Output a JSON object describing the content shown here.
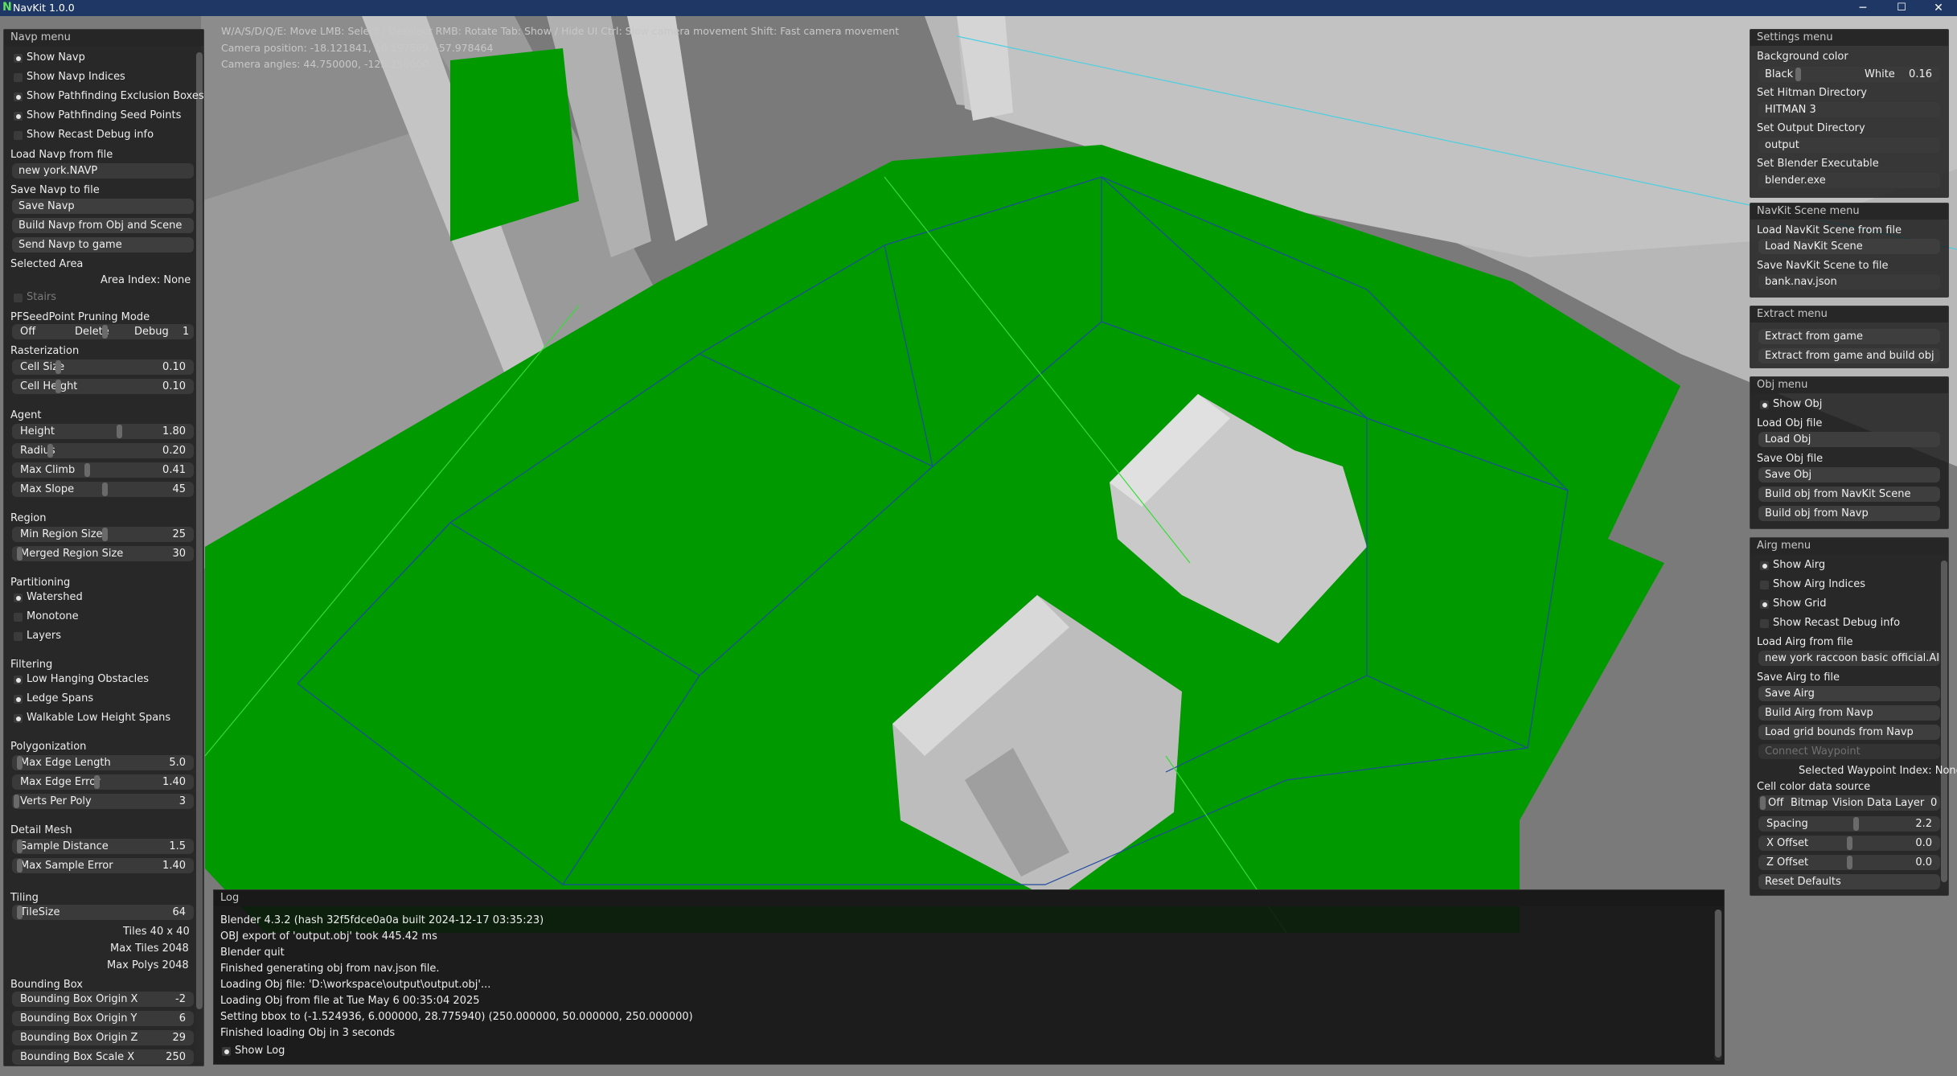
{
  "window": {
    "title": "NavKit 1.0.0",
    "minimize": "─",
    "maximize": "☐",
    "close": "✕"
  },
  "hud": {
    "controls": "W/A/S/D/Q/E: Move  LMB: Select / Deselect RMB: Rotate  Tab: Show / Hide UI  Ctrl: Slow camera movement  Shift: Fast camera movement",
    "camera_position": "Camera position: -18.121841, 10.197569, -57.978464",
    "camera_angles": "Camera angles: 44.750000, -125.250000"
  },
  "navp": {
    "title": "Navp menu",
    "show_navp": "Show Navp",
    "show_indices": "Show Navp Indices",
    "show_excl": "Show Pathfinding Exclusion Boxes",
    "show_seed": "Show Pathfinding Seed Points",
    "show_recast": "Show Recast Debug info",
    "load_label": "Load Navp from file",
    "load_value": "new york.NAVP",
    "save_label": "Save Navp to file",
    "save_btn": "Save Navp",
    "build_btn": "Build Navp from Obj and Scene",
    "send_btn": "Send Navp to game",
    "selected_area": "Selected Area",
    "area_index": "Area Index: None",
    "stairs": "Stairs",
    "pf_mode": "PFSeedPoint Pruning Mode",
    "pf_off": "Off",
    "pf_delete": "Delete",
    "pf_debug": "Debug",
    "pf_val": "1",
    "rasterization": "Rasterization",
    "cell_size": "Cell Size",
    "cell_size_v": "0.10",
    "cell_height": "Cell Height",
    "cell_height_v": "0.10",
    "agent": "Agent",
    "height": "Height",
    "height_v": "1.80",
    "radius": "Radius",
    "radius_v": "0.20",
    "max_climb": "Max Climb",
    "max_climb_v": "0.41",
    "max_slope": "Max Slope",
    "max_slope_v": "45",
    "region": "Region",
    "min_region": "Min Region Size",
    "min_region_v": "25",
    "merged_region": "Merged Region Size",
    "merged_region_v": "30",
    "partitioning": "Partitioning",
    "watershed": "Watershed",
    "monotone": "Monotone",
    "layers": "Layers",
    "filtering": "Filtering",
    "low_hanging": "Low Hanging Obstacles",
    "ledge": "Ledge Spans",
    "walkable_low": "Walkable Low Height Spans",
    "polygonization": "Polygonization",
    "max_edge_len": "Max Edge Length",
    "max_edge_len_v": "5.0",
    "max_edge_err": "Max Edge Error",
    "max_edge_err_v": "1.40",
    "verts_per_poly": "Verts Per Poly",
    "verts_per_poly_v": "3",
    "detail_mesh": "Detail Mesh",
    "sample_dist": "Sample Distance",
    "sample_dist_v": "1.5",
    "max_sample_err": "Max Sample Error",
    "max_sample_err_v": "1.40",
    "tiling": "Tiling",
    "tile_size": "TileSize",
    "tile_size_v": "64",
    "tiles": "Tiles  40 x 40",
    "max_tiles": "Max Tiles  2048",
    "max_polys": "Max Polys  2048",
    "bbox": "Bounding Box",
    "bbox_ox": "Bounding Box Origin X",
    "bbox_ox_v": "-2",
    "bbox_oy": "Bounding Box Origin Y",
    "bbox_oy_v": "6",
    "bbox_oz": "Bounding Box Origin Z",
    "bbox_oz_v": "29",
    "bbox_sx": "Bounding Box Scale X",
    "bbox_sx_v": "250"
  },
  "settings": {
    "title": "Settings menu",
    "bg_color": "Background color",
    "black": "Black",
    "white": "White",
    "bg_v": "0.16",
    "hitman_dir": "Set Hitman Directory",
    "hitman_v": "HITMAN 3",
    "output_dir": "Set Output Directory",
    "output_v": "output",
    "blender": "Set Blender Executable",
    "blender_v": "blender.exe"
  },
  "scene": {
    "title": "NavKit Scene menu",
    "load_label": "Load NavKit Scene from file",
    "load_btn": "Load NavKit Scene",
    "save_label": "Save NavKit Scene to file",
    "save_v": "bank.nav.json"
  },
  "extract": {
    "title": "Extract menu",
    "extract_btn": "Extract from game",
    "extract_build_btn": "Extract from game and build obj"
  },
  "obj": {
    "title": "Obj menu",
    "show_obj": "Show Obj",
    "load_label": "Load Obj file",
    "load_btn": "Load Obj",
    "save_label": "Save Obj file",
    "save_btn": "Save Obj",
    "build_scene_btn": "Build obj from NavKit Scene",
    "build_navp_btn": "Build obj from Navp"
  },
  "airg": {
    "title": "Airg menu",
    "show_airg": "Show Airg",
    "show_indices": "Show Airg Indices",
    "show_grid": "Show Grid",
    "show_recast": "Show Recast Debug info",
    "load_label": "Load Airg from file",
    "load_v": "new york raccoon basic official.AIRG",
    "save_label": "Save Airg to file",
    "save_btn": "Save Airg",
    "build_btn": "Build Airg from Navp",
    "load_grid_btn": "Load grid bounds from Navp",
    "connect_btn": "Connect Waypoint",
    "selected_wp": "Selected Waypoint Index: None",
    "cell_color": "Cell color data source",
    "ds_off": "Off",
    "ds_bitmap": "Bitmap",
    "ds_vision": "Vision Data",
    "ds_layer": "Layer",
    "ds_val": "0",
    "spacing": "Spacing",
    "spacing_v": "2.2",
    "x_offset": "X Offset",
    "x_offset_v": "0.0",
    "z_offset": "Z Offset",
    "z_offset_v": "0.0",
    "reset_btn": "Reset Defaults"
  },
  "log": {
    "title": "Log",
    "lines": [
      "Blender 4.3.2 (hash 32f5fdce0a0a built 2024-12-17 03:35:23)",
      "OBJ export of 'output.obj' took 445.42 ms",
      "Blender quit",
      "Finished generating obj from nav.json file.",
      "Loading Obj file: 'D:\\workspace\\output\\output.obj'...",
      "Loading Obj from file at Tue May  6 00:35:04 2025",
      "Setting bbox to (-1.524936, 6.000000, 28.775940) (250.000000, 50.000000, 250.000000)",
      "Finished loading Obj in 3 seconds"
    ],
    "show_log": "Show Log"
  },
  "colors": {
    "navmesh": "#009900",
    "edge": "#1f4aa0",
    "bright_edge": "#33dd33",
    "wall": "#bcbcbc"
  }
}
